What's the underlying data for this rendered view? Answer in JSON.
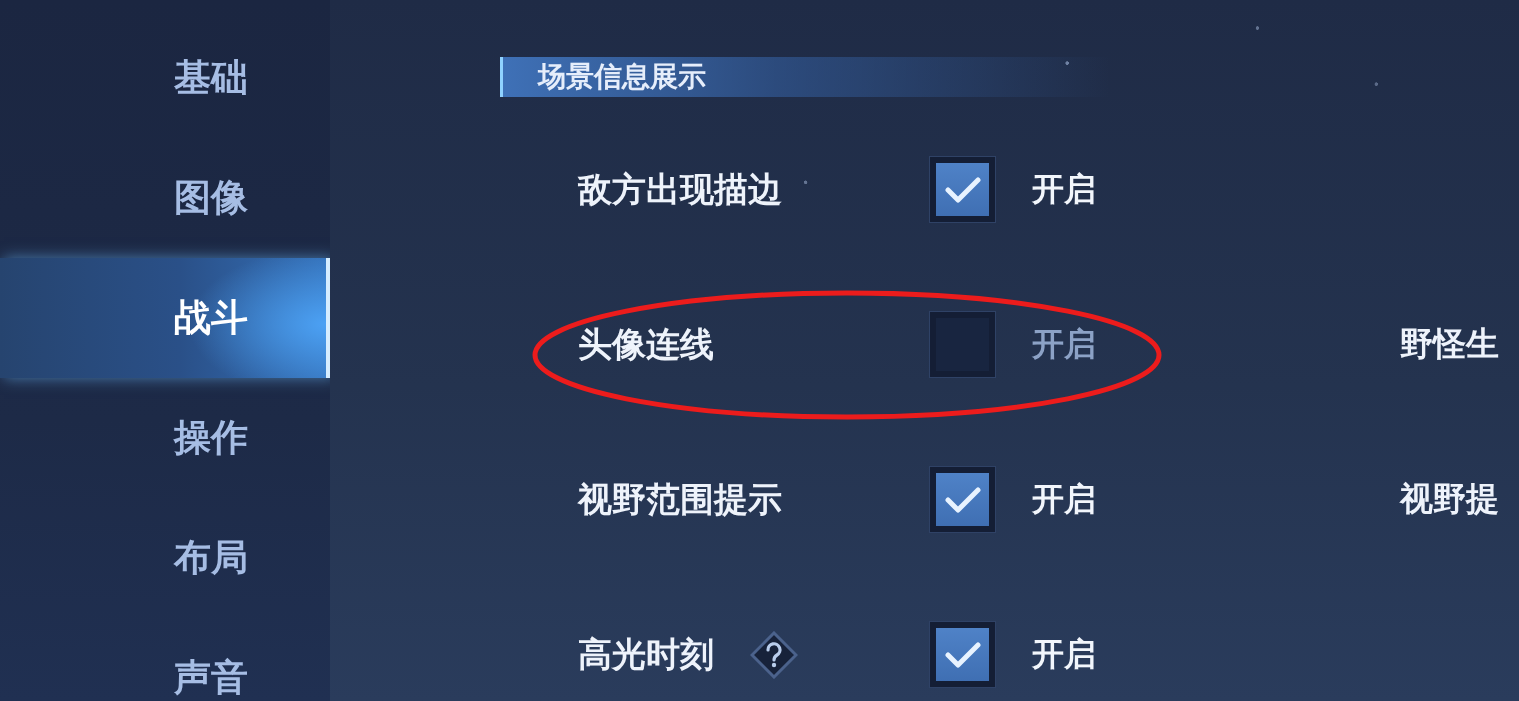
{
  "sidebar": {
    "items": [
      {
        "label": "基础",
        "selected": false
      },
      {
        "label": "图像",
        "selected": false
      },
      {
        "label": "战斗",
        "selected": true
      },
      {
        "label": "操作",
        "selected": false
      },
      {
        "label": "布局",
        "selected": false
      },
      {
        "label": "声音",
        "selected": false
      }
    ]
  },
  "section": {
    "title": "场景信息展示"
  },
  "rows": [
    {
      "label": "敌方出现描边",
      "help": false,
      "checked": true,
      "option": "开启",
      "circled": false
    },
    {
      "label": "头像连线",
      "help": false,
      "checked": false,
      "option": "开启",
      "circled": true,
      "right_label": "野怪生"
    },
    {
      "label": "视野范围提示",
      "help": false,
      "checked": true,
      "option": "开启",
      "circled": false,
      "right_label": "视野提"
    },
    {
      "label": "高光时刻",
      "help": true,
      "checked": true,
      "option": "开启",
      "circled": false
    }
  ]
}
